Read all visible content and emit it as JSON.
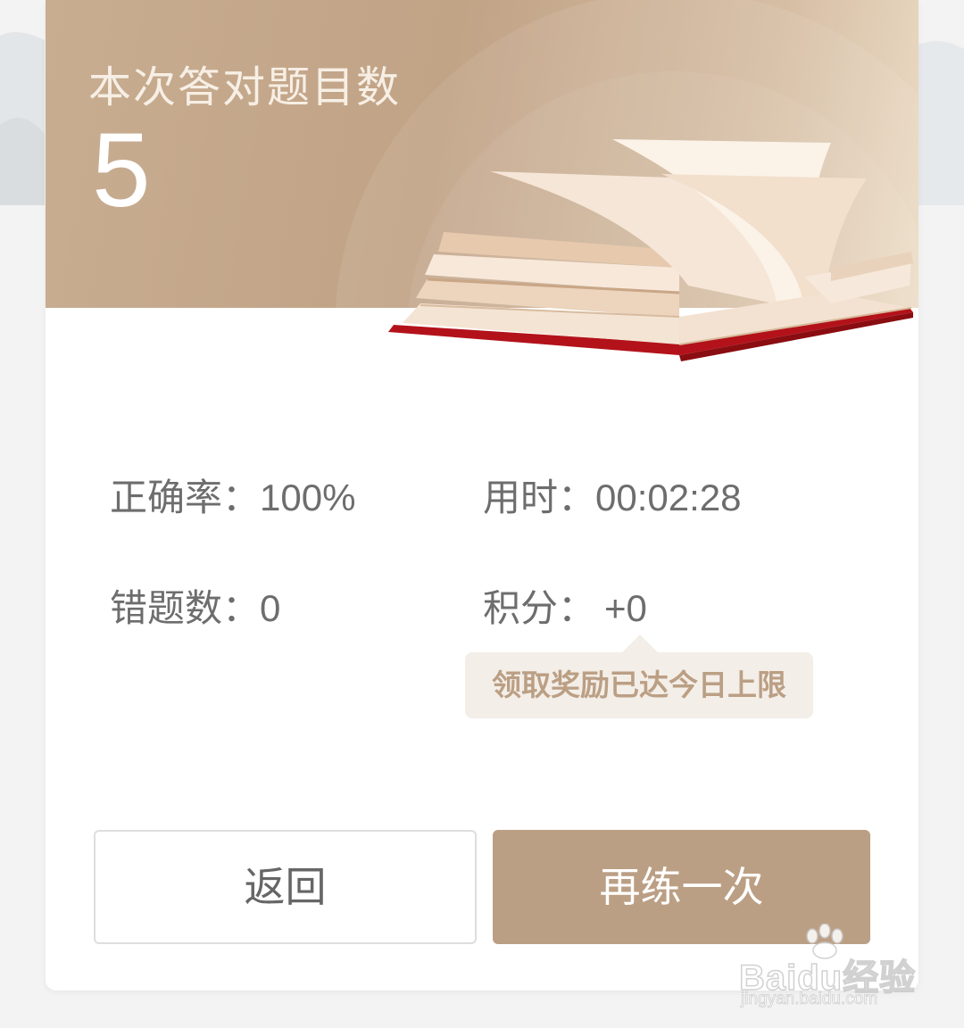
{
  "header": {
    "title": "本次答对题目数",
    "score": "5"
  },
  "stats": {
    "accuracy": {
      "label": "正确率：",
      "value": "100%"
    },
    "time": {
      "label": "用时：",
      "value": "00:02:28"
    },
    "wrong": {
      "label": "错题数：",
      "value": "0"
    },
    "points": {
      "label": "积分：",
      "value": "+0"
    }
  },
  "tip": "领取奖励已达今日上限",
  "buttons": {
    "back": "返回",
    "again": "再练一次"
  },
  "watermark": {
    "text": "Baidu经验",
    "sub": "jingyan.baidu.com"
  },
  "colors": {
    "accent": "#bb9f84",
    "header": "#c1a386",
    "book_cover": "#b3121a"
  }
}
